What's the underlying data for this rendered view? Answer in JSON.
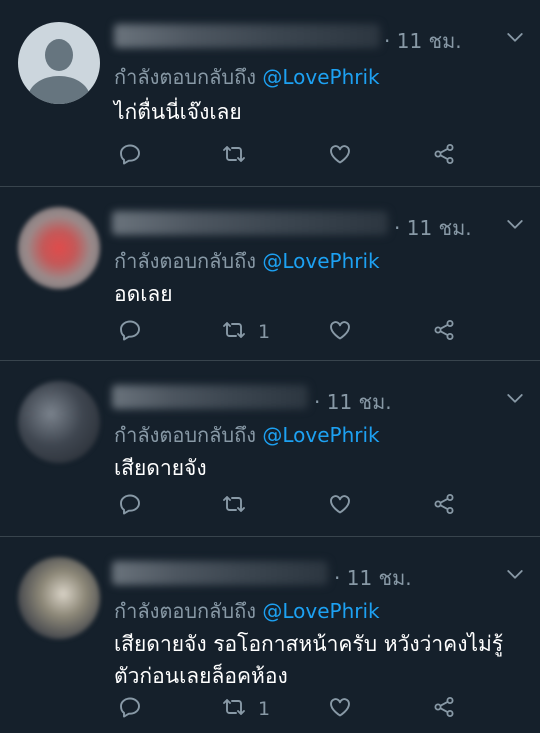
{
  "tweets": [
    {
      "time": "· 11 ชม.",
      "reply_prefix": "กำลังตอบกลับถึง",
      "mention": "@LovePhrik",
      "text": "ไก่ตื่นนี่เจ๊งเลย",
      "retweets": "",
      "avatar_icon": "default-avatar-icon"
    },
    {
      "time": "· 11 ชม.",
      "reply_prefix": "กำลังตอบกลับถึง",
      "mention": "@LovePhrik",
      "text": "อดเลย",
      "retweets": "1",
      "avatar_icon": "blurred-avatar"
    },
    {
      "time": "· 11 ชม.",
      "reply_prefix": "กำลังตอบกลับถึง",
      "mention": "@LovePhrik",
      "text": "เสียดายจัง",
      "retweets": "",
      "avatar_icon": "blurred-avatar"
    },
    {
      "time": "· 11 ชม.",
      "reply_prefix": "กำลังตอบกลับถึง",
      "mention": "@LovePhrik",
      "text": "เสียดายจัง รอโอกาสหน้าครับ หวังว่าคงไม่รู้ตัวก่อนเลยล็อคห้อง",
      "retweets": "1",
      "avatar_icon": "blurred-avatar"
    }
  ],
  "icons": {
    "reply": "reply-icon",
    "retweet": "retweet-icon",
    "like": "heart-icon",
    "share": "share-icon",
    "menu": "chevron-down-icon"
  },
  "colors": {
    "background": "#15202b",
    "secondary_text": "#8899a6",
    "accent": "#1da1f2",
    "divider": "#38444d"
  }
}
